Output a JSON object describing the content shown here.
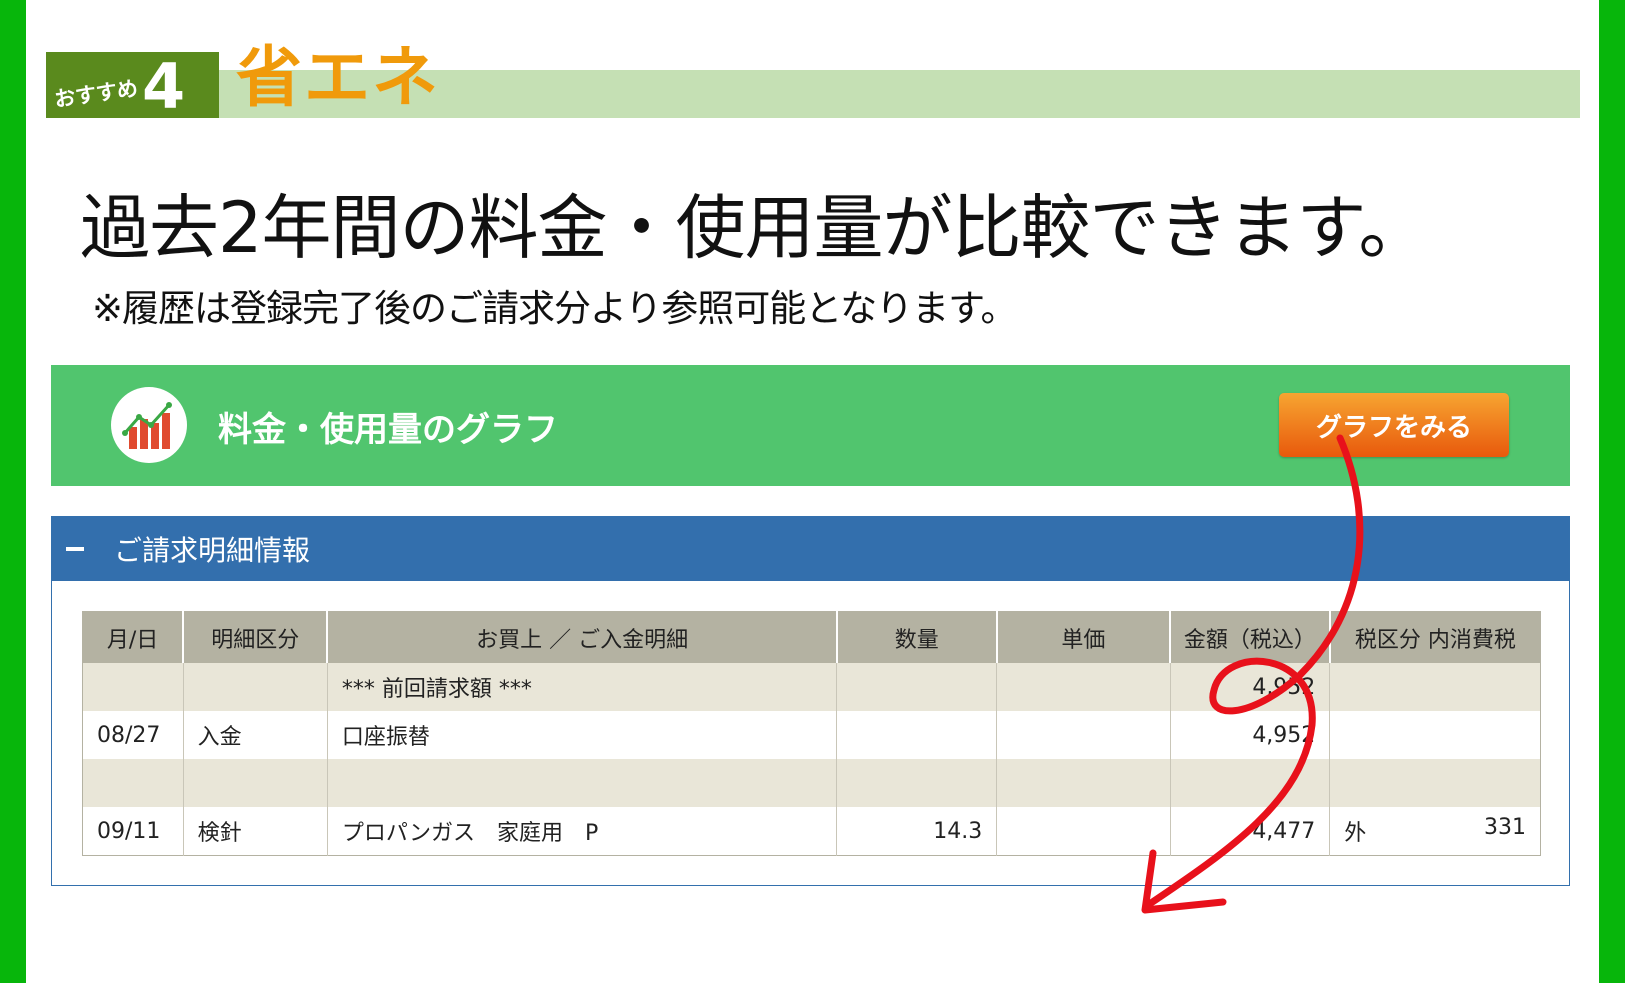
{
  "recommend": {
    "badge_label": "おすすめ",
    "badge_number": "4",
    "title": "省エネ"
  },
  "headline": "過去2年間の料金・使用量が比較できます。",
  "note": "※履歴は登録完了後のご請求分より参照可能となります。",
  "graph_panel": {
    "title": "料金・使用量のグラフ",
    "button_label": "グラフをみる",
    "icon": "bar-chart-icon"
  },
  "billing": {
    "header": "ご請求明細情報",
    "columns": [
      "月/日",
      "明細区分",
      "お買上 ／ ご入金明細",
      "数量",
      "単価",
      "金額（税込）",
      "税区分 内消費税"
    ],
    "rows": [
      {
        "date": "",
        "category": "",
        "detail": "*** 前回請求額 ***",
        "qty": "",
        "unit_price": "",
        "amount": "4,952",
        "tax_class": "",
        "tax": ""
      },
      {
        "date": "08/27",
        "category": "入金",
        "detail": "口座振替",
        "qty": "",
        "unit_price": "",
        "amount": "4,952",
        "tax_class": "",
        "tax": ""
      },
      {
        "date": "",
        "category": "",
        "detail": "",
        "qty": "",
        "unit_price": "",
        "amount": "",
        "tax_class": "",
        "tax": ""
      },
      {
        "date": "09/11",
        "category": "検針",
        "detail": "プロパンガス　家庭用　P",
        "qty": "14.3",
        "unit_price": "",
        "amount": "4,477",
        "tax_class": "外",
        "tax": "331"
      }
    ]
  },
  "colors": {
    "side_bar": "#07b60b",
    "badge": "#5a8a1d",
    "accent_orange": "#f09a0b",
    "graph_panel": "#51c56e",
    "billing_header": "#336fad",
    "annotation_arrow": "#e8111b"
  }
}
